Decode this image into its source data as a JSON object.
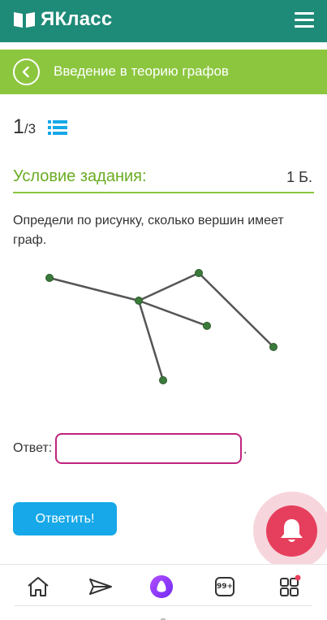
{
  "app": {
    "brand": "ЯКласс",
    "brand_color": "#1e8a78",
    "accent_green": "#8cc63f"
  },
  "lesson": {
    "title": "Введение в теорию графов"
  },
  "progress": {
    "current": "1",
    "separator": "/",
    "total": "3"
  },
  "condition": {
    "title": "Условие задания:",
    "points": "1 Б."
  },
  "task": {
    "text": "Определи по рисунку, сколько вершин имеет граф."
  },
  "graph": {
    "vertex_color": "#3a7a3a",
    "edge_color": "#555555",
    "vertices": [
      "v1",
      "v2",
      "v3",
      "v4",
      "v5",
      "v6"
    ],
    "edges": [
      [
        "v1",
        "v2"
      ],
      [
        "v2",
        "v3"
      ],
      [
        "v2",
        "v4"
      ],
      [
        "v2",
        "v5"
      ],
      [
        "v3",
        "v6"
      ]
    ]
  },
  "answer": {
    "label": "Ответ:",
    "value": "",
    "suffix": "."
  },
  "submit": {
    "label": "Ответить!"
  },
  "bottom_nav": {
    "items": [
      "home-icon",
      "send-icon",
      "alice-icon",
      "notifications-99-icon",
      "apps-grid-icon"
    ],
    "badge": "99+"
  }
}
